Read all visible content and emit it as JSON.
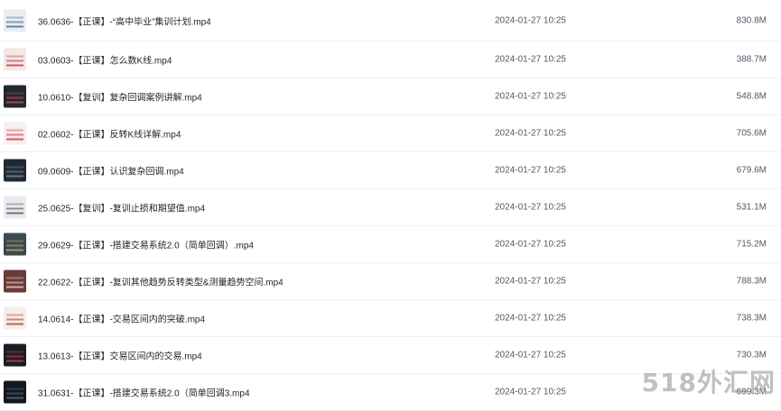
{
  "files": [
    {
      "name": "36.0636-【正课】-“高中毕业”集训计划.mp4",
      "date": "2024-01-27 10:25",
      "size": "830.8M",
      "thumb_bg": "#e9edf2",
      "thumb_accent": "#3b6b8c"
    },
    {
      "name": "03.0603-【正课】怎么数K线.mp4",
      "date": "2024-01-27 10:25",
      "size": "388.7M",
      "thumb_bg": "#f3e7e7",
      "thumb_accent": "#c8363b"
    },
    {
      "name": "10.0610-【复训】复杂回调案例讲解.mp4",
      "date": "2024-01-27 10:25",
      "size": "548.8M",
      "thumb_bg": "#1f2933",
      "thumb_accent": "#e0434a"
    },
    {
      "name": "02.0602-【正课】反转K线详解.mp4",
      "date": "2024-01-27 10:25",
      "size": "705.6M",
      "thumb_bg": "#f7eeee",
      "thumb_accent": "#d0343a"
    },
    {
      "name": "09.0609-【正课】认识复杂回调.mp4",
      "date": "2024-01-27 10:25",
      "size": "679.6M",
      "thumb_bg": "#202a34",
      "thumb_accent": "#7a8a99"
    },
    {
      "name": "25.0625-【复训】-复训止损和期望值.mp4",
      "date": "2024-01-27 10:25",
      "size": "531.1M",
      "thumb_bg": "#e8ebee",
      "thumb_accent": "#4b5563"
    },
    {
      "name": "29.0629-【正课】-搭建交易系统2.0（简单回调）.mp4",
      "date": "2024-01-27 10:25",
      "size": "715.2M",
      "thumb_bg": "#3a4a4f",
      "thumb_accent": "#c7a46a"
    },
    {
      "name": "22.0622-【正课】-复训其他趋势反转类型&测量趋势空间.mp4",
      "date": "2024-01-27 10:25",
      "size": "788.3M",
      "thumb_bg": "#6b3a3a",
      "thumb_accent": "#e9d7c6"
    },
    {
      "name": "14.0614-【正课】-交易区间内的突破.mp4",
      "date": "2024-01-27 10:25",
      "size": "738.3M",
      "thumb_bg": "#f4eded",
      "thumb_accent": "#c0392b"
    },
    {
      "name": "13.0613-【正课】交易区间内的交易.mp4",
      "date": "2024-01-27 10:25",
      "size": "730.3M",
      "thumb_bg": "#182026",
      "thumb_accent": "#d63a40"
    },
    {
      "name": "31.0631-【正课】-搭建交易系统2.0（简单回调3.mp4",
      "date": "2024-01-27 10:25",
      "size": "699.3M",
      "thumb_bg": "#111820",
      "thumb_accent": "#5b6b7a"
    }
  ],
  "watermark": "518外汇网"
}
